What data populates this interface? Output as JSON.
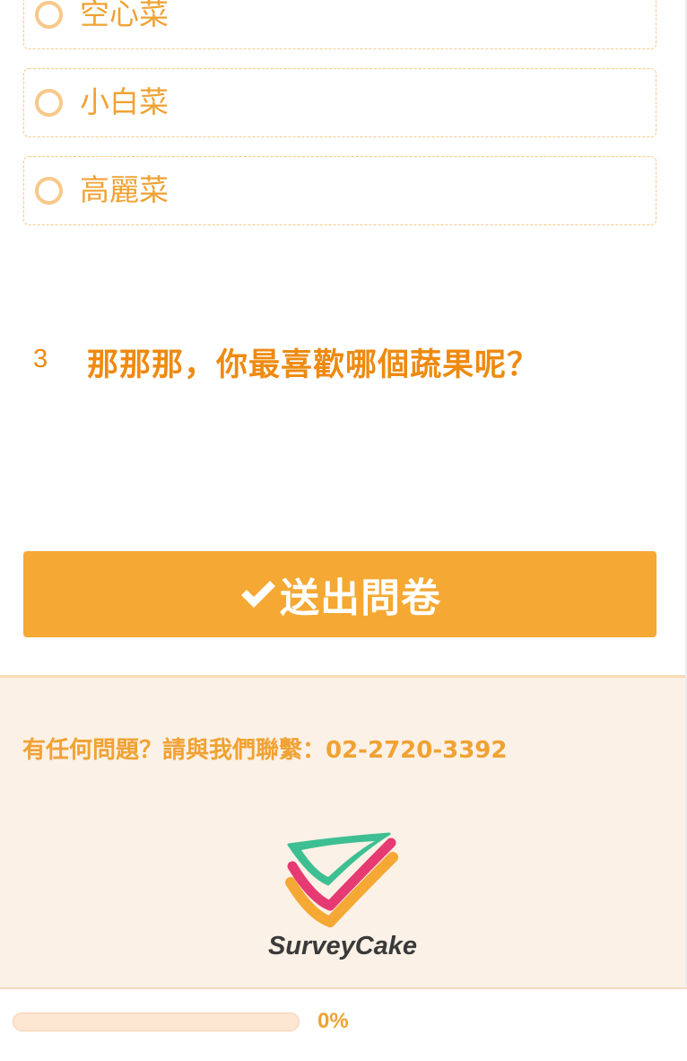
{
  "options": [
    {
      "label": "空心菜"
    },
    {
      "label": "小白菜"
    },
    {
      "label": "高麗菜"
    }
  ],
  "question": {
    "number": "3",
    "title": "那那那，你最喜歡哪個蔬果呢？"
  },
  "submit": {
    "label": "送出問卷",
    "icon": "check-icon"
  },
  "footer": {
    "contact": "有任何問題？請與我們聯繫：02-2720-3392",
    "brand": "SurveyCake"
  },
  "progress": {
    "value": 0,
    "label": "0%"
  },
  "colors": {
    "accent": "#f5a833",
    "text_accent": "#ee8a10",
    "footer_bg": "#fcf1e6"
  }
}
